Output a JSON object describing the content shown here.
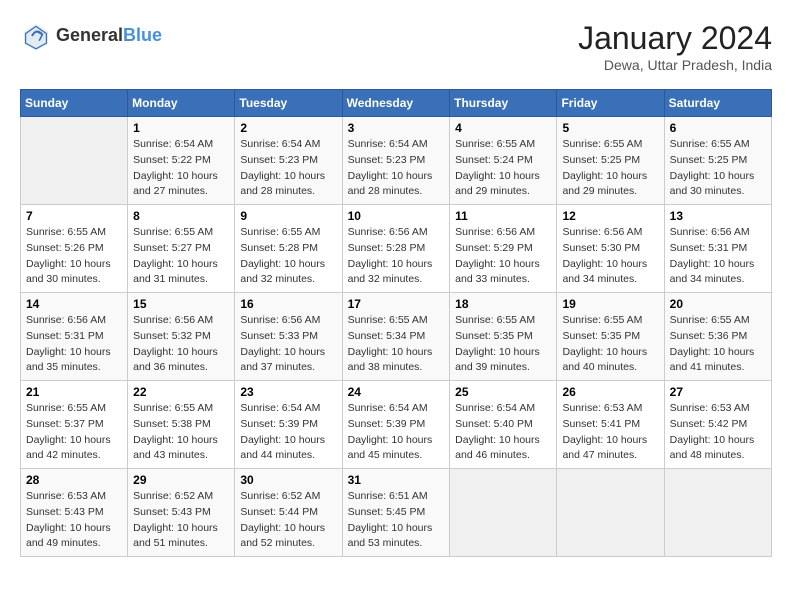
{
  "logo": {
    "line1": "General",
    "line2": "Blue"
  },
  "title": "January 2024",
  "location": "Dewa, Uttar Pradesh, India",
  "headers": [
    "Sunday",
    "Monday",
    "Tuesday",
    "Wednesday",
    "Thursday",
    "Friday",
    "Saturday"
  ],
  "weeks": [
    [
      {
        "day": "",
        "sunrise": "",
        "sunset": "",
        "daylight": ""
      },
      {
        "day": "1",
        "sunrise": "Sunrise: 6:54 AM",
        "sunset": "Sunset: 5:22 PM",
        "daylight": "Daylight: 10 hours and 27 minutes."
      },
      {
        "day": "2",
        "sunrise": "Sunrise: 6:54 AM",
        "sunset": "Sunset: 5:23 PM",
        "daylight": "Daylight: 10 hours and 28 minutes."
      },
      {
        "day": "3",
        "sunrise": "Sunrise: 6:54 AM",
        "sunset": "Sunset: 5:23 PM",
        "daylight": "Daylight: 10 hours and 28 minutes."
      },
      {
        "day": "4",
        "sunrise": "Sunrise: 6:55 AM",
        "sunset": "Sunset: 5:24 PM",
        "daylight": "Daylight: 10 hours and 29 minutes."
      },
      {
        "day": "5",
        "sunrise": "Sunrise: 6:55 AM",
        "sunset": "Sunset: 5:25 PM",
        "daylight": "Daylight: 10 hours and 29 minutes."
      },
      {
        "day": "6",
        "sunrise": "Sunrise: 6:55 AM",
        "sunset": "Sunset: 5:25 PM",
        "daylight": "Daylight: 10 hours and 30 minutes."
      }
    ],
    [
      {
        "day": "7",
        "sunrise": "Sunrise: 6:55 AM",
        "sunset": "Sunset: 5:26 PM",
        "daylight": "Daylight: 10 hours and 30 minutes."
      },
      {
        "day": "8",
        "sunrise": "Sunrise: 6:55 AM",
        "sunset": "Sunset: 5:27 PM",
        "daylight": "Daylight: 10 hours and 31 minutes."
      },
      {
        "day": "9",
        "sunrise": "Sunrise: 6:55 AM",
        "sunset": "Sunset: 5:28 PM",
        "daylight": "Daylight: 10 hours and 32 minutes."
      },
      {
        "day": "10",
        "sunrise": "Sunrise: 6:56 AM",
        "sunset": "Sunset: 5:28 PM",
        "daylight": "Daylight: 10 hours and 32 minutes."
      },
      {
        "day": "11",
        "sunrise": "Sunrise: 6:56 AM",
        "sunset": "Sunset: 5:29 PM",
        "daylight": "Daylight: 10 hours and 33 minutes."
      },
      {
        "day": "12",
        "sunrise": "Sunrise: 6:56 AM",
        "sunset": "Sunset: 5:30 PM",
        "daylight": "Daylight: 10 hours and 34 minutes."
      },
      {
        "day": "13",
        "sunrise": "Sunrise: 6:56 AM",
        "sunset": "Sunset: 5:31 PM",
        "daylight": "Daylight: 10 hours and 34 minutes."
      }
    ],
    [
      {
        "day": "14",
        "sunrise": "Sunrise: 6:56 AM",
        "sunset": "Sunset: 5:31 PM",
        "daylight": "Daylight: 10 hours and 35 minutes."
      },
      {
        "day": "15",
        "sunrise": "Sunrise: 6:56 AM",
        "sunset": "Sunset: 5:32 PM",
        "daylight": "Daylight: 10 hours and 36 minutes."
      },
      {
        "day": "16",
        "sunrise": "Sunrise: 6:56 AM",
        "sunset": "Sunset: 5:33 PM",
        "daylight": "Daylight: 10 hours and 37 minutes."
      },
      {
        "day": "17",
        "sunrise": "Sunrise: 6:55 AM",
        "sunset": "Sunset: 5:34 PM",
        "daylight": "Daylight: 10 hours and 38 minutes."
      },
      {
        "day": "18",
        "sunrise": "Sunrise: 6:55 AM",
        "sunset": "Sunset: 5:35 PM",
        "daylight": "Daylight: 10 hours and 39 minutes."
      },
      {
        "day": "19",
        "sunrise": "Sunrise: 6:55 AM",
        "sunset": "Sunset: 5:35 PM",
        "daylight": "Daylight: 10 hours and 40 minutes."
      },
      {
        "day": "20",
        "sunrise": "Sunrise: 6:55 AM",
        "sunset": "Sunset: 5:36 PM",
        "daylight": "Daylight: 10 hours and 41 minutes."
      }
    ],
    [
      {
        "day": "21",
        "sunrise": "Sunrise: 6:55 AM",
        "sunset": "Sunset: 5:37 PM",
        "daylight": "Daylight: 10 hours and 42 minutes."
      },
      {
        "day": "22",
        "sunrise": "Sunrise: 6:55 AM",
        "sunset": "Sunset: 5:38 PM",
        "daylight": "Daylight: 10 hours and 43 minutes."
      },
      {
        "day": "23",
        "sunrise": "Sunrise: 6:54 AM",
        "sunset": "Sunset: 5:39 PM",
        "daylight": "Daylight: 10 hours and 44 minutes."
      },
      {
        "day": "24",
        "sunrise": "Sunrise: 6:54 AM",
        "sunset": "Sunset: 5:39 PM",
        "daylight": "Daylight: 10 hours and 45 minutes."
      },
      {
        "day": "25",
        "sunrise": "Sunrise: 6:54 AM",
        "sunset": "Sunset: 5:40 PM",
        "daylight": "Daylight: 10 hours and 46 minutes."
      },
      {
        "day": "26",
        "sunrise": "Sunrise: 6:53 AM",
        "sunset": "Sunset: 5:41 PM",
        "daylight": "Daylight: 10 hours and 47 minutes."
      },
      {
        "day": "27",
        "sunrise": "Sunrise: 6:53 AM",
        "sunset": "Sunset: 5:42 PM",
        "daylight": "Daylight: 10 hours and 48 minutes."
      }
    ],
    [
      {
        "day": "28",
        "sunrise": "Sunrise: 6:53 AM",
        "sunset": "Sunset: 5:43 PM",
        "daylight": "Daylight: 10 hours and 49 minutes."
      },
      {
        "day": "29",
        "sunrise": "Sunrise: 6:52 AM",
        "sunset": "Sunset: 5:43 PM",
        "daylight": "Daylight: 10 hours and 51 minutes."
      },
      {
        "day": "30",
        "sunrise": "Sunrise: 6:52 AM",
        "sunset": "Sunset: 5:44 PM",
        "daylight": "Daylight: 10 hours and 52 minutes."
      },
      {
        "day": "31",
        "sunrise": "Sunrise: 6:51 AM",
        "sunset": "Sunset: 5:45 PM",
        "daylight": "Daylight: 10 hours and 53 minutes."
      },
      {
        "day": "",
        "sunrise": "",
        "sunset": "",
        "daylight": ""
      },
      {
        "day": "",
        "sunrise": "",
        "sunset": "",
        "daylight": ""
      },
      {
        "day": "",
        "sunrise": "",
        "sunset": "",
        "daylight": ""
      }
    ]
  ]
}
